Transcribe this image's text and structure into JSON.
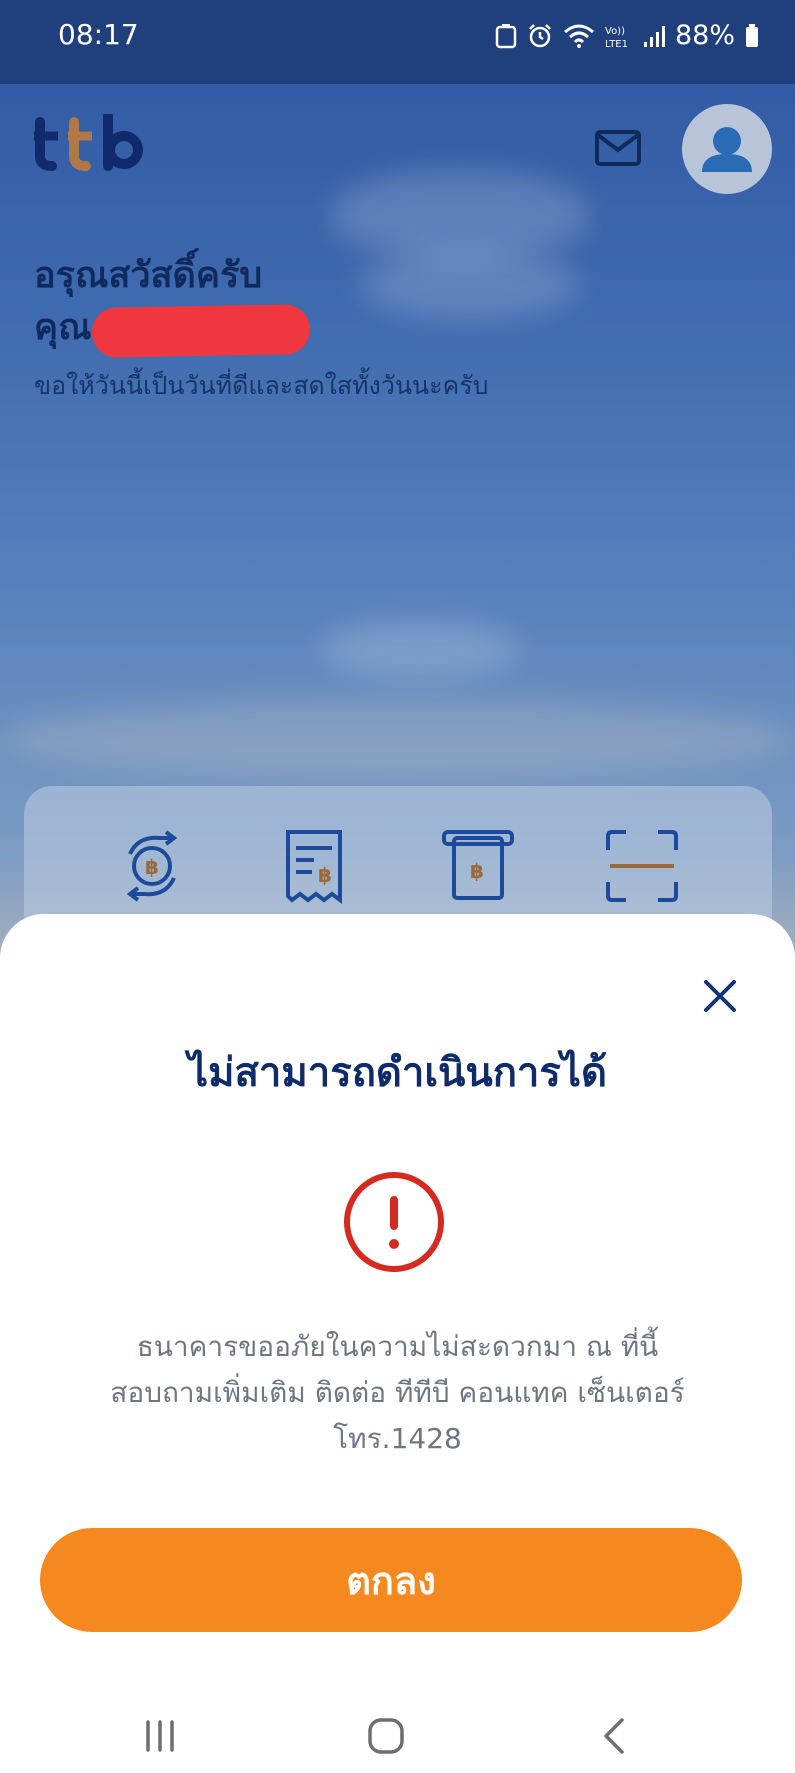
{
  "status_bar": {
    "time": "08:17",
    "battery": "88%",
    "icons": [
      "recycle-icon",
      "alarm-icon",
      "wifi-icon",
      "volte-icon",
      "signal-icon",
      "battery-icon"
    ]
  },
  "header": {
    "logo_text": "ttb",
    "icons": [
      "mail-icon",
      "profile-avatar-icon"
    ]
  },
  "greeting": {
    "title": "อรุณสวัสดิ์ครับ",
    "name_prefix": "คุณ",
    "subtitle": "ขอให้วันนี้เป็นวันที่ดีและสดใสทั้งวันนะครับ"
  },
  "quick_actions": {
    "icons": [
      "transfer-icon",
      "bill-payment-icon",
      "top-up-icon",
      "scan-icon"
    ]
  },
  "dialog": {
    "title": "ไม่สามารถดำเนินการได้",
    "message_line1": "ธนาคารขออภัยในความไม่สะดวกมา ณ ที่นี้",
    "message_line2": "สอบถามเพิ่มเติม ติดต่อ ทีทีบี คอนแทค เซ็นเตอร์",
    "message_line3": "โทร.1428",
    "ok_label": "ตกลง"
  },
  "colors": {
    "status_bar": "#1f3f7d",
    "title_navy": "#0f2b6b",
    "button_orange": "#f5891f",
    "alert_red": "#d42a20",
    "message_gray": "#6f7683"
  }
}
